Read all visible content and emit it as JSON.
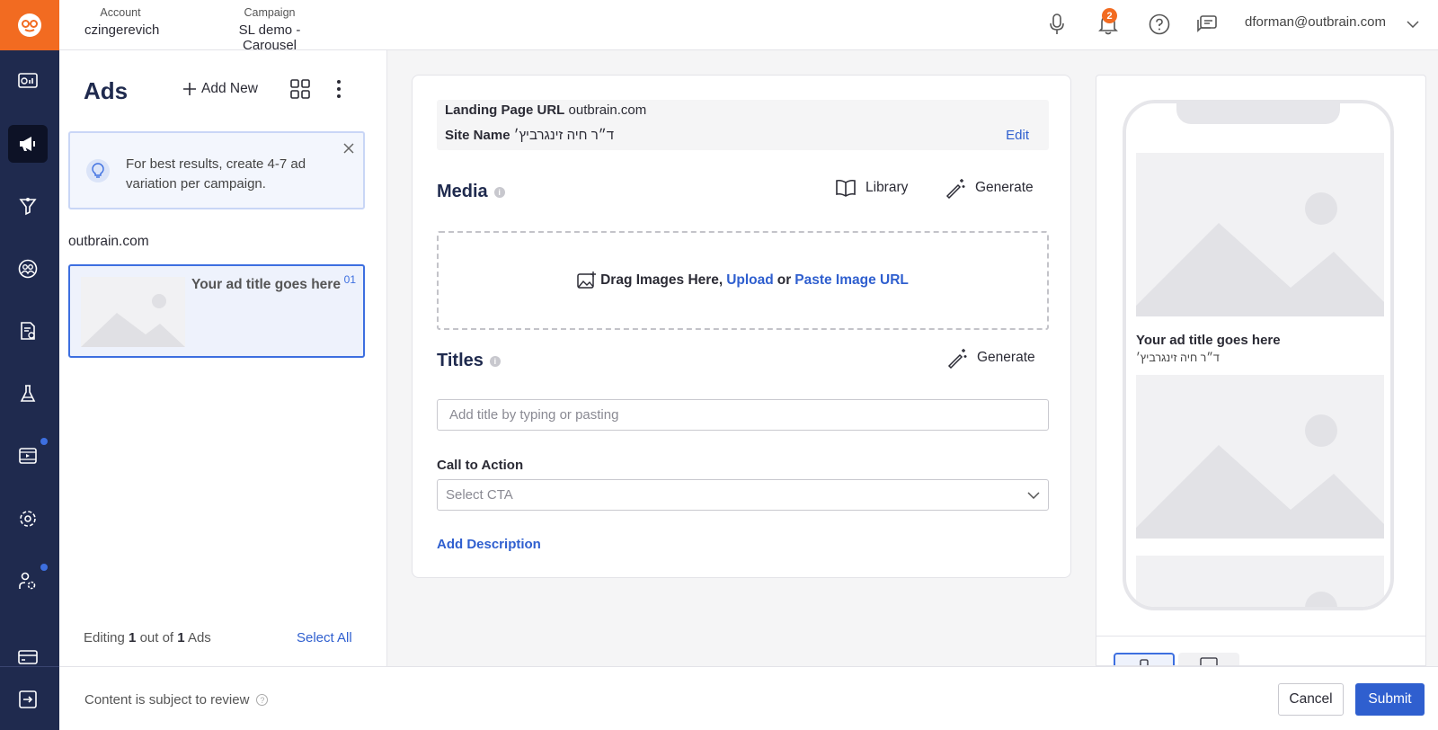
{
  "header": {
    "account_label": "Account",
    "account_value": "czingerevich",
    "campaign_label": "Campaign",
    "campaign_value": "SL demo - Carousel",
    "notifications_count": "2",
    "user_email": "dforman@outbrain.com"
  },
  "ads_panel": {
    "title": "Ads",
    "add_new_label": "Add New",
    "tip_text": "For best results, create 4-7 ad variation per campaign.",
    "site_label": "outbrain.com",
    "ad_card": {
      "title": "Your ad title goes here",
      "number": "01"
    },
    "editing_prefix": "Editing",
    "editing_count": "1",
    "editing_mid": "out of",
    "editing_total": "1",
    "editing_suffix": "Ads",
    "select_all_label": "Select All"
  },
  "editor": {
    "landing_page_label": "Landing Page URL",
    "landing_page_value": "outbrain.com",
    "site_name_label": "Site Name",
    "site_name_value": "ד״ר חיה זינגרביץ׳",
    "edit_label": "Edit",
    "media_heading": "Media",
    "library_label": "Library",
    "generate_label": "Generate",
    "drop_text": "Drag Images Here,",
    "upload_label": "Upload",
    "or_text": "or",
    "paste_url_label": "Paste Image URL",
    "titles_heading": "Titles",
    "title_placeholder": "Add title by typing or pasting",
    "cta_label": "Call to Action",
    "cta_placeholder": "Select CTA",
    "add_description_label": "Add Description"
  },
  "preview": {
    "ad_title": "Your ad title goes here",
    "site_name": "ד״ר חיה זינגרביץ׳"
  },
  "footer": {
    "review_text": "Content is subject to review",
    "cancel_label": "Cancel",
    "submit_label": "Submit"
  },
  "colors": {
    "brand_orange": "#f26b21",
    "rail_navy": "#1f2a4e",
    "accent_blue": "#2f5fcf"
  },
  "icons": {
    "rail": [
      "dashboard-icon",
      "megaphone-icon",
      "funnel-icon",
      "audience-icon",
      "report-icon",
      "flask-icon",
      "video-icon",
      "settings-icon",
      "user-settings-icon",
      "billing-icon",
      "logout-icon"
    ]
  }
}
